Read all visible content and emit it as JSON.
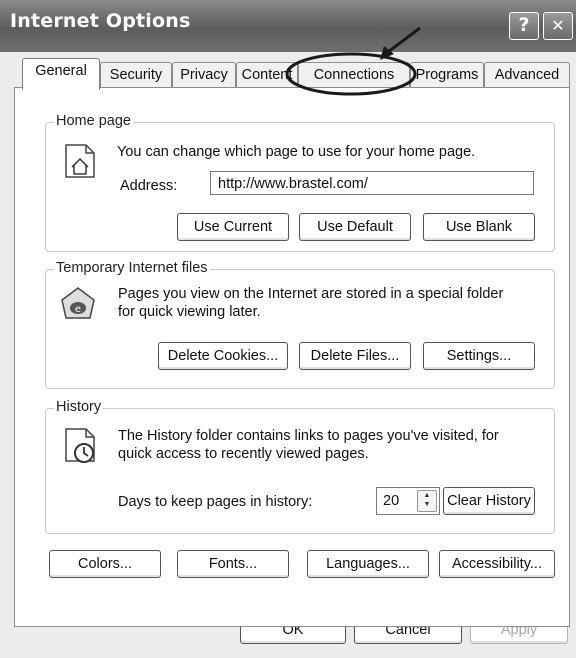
{
  "window": {
    "title": "Internet Options",
    "help_glyph": "?",
    "close_glyph": "✕"
  },
  "tabs": [
    {
      "label": "General"
    },
    {
      "label": "Security"
    },
    {
      "label": "Privacy"
    },
    {
      "label": "Content"
    },
    {
      "label": "Connections"
    },
    {
      "label": "Programs"
    },
    {
      "label": "Advanced"
    }
  ],
  "home_page": {
    "title": "Home page",
    "description": "You can change which page to use for your home page.",
    "address_label": "Address:",
    "address_value": "http://www.brastel.com/",
    "buttons": {
      "use_current": "Use Current",
      "use_default": "Use Default",
      "use_blank": "Use Blank"
    }
  },
  "temp_files": {
    "title": "Temporary Internet files",
    "description_line1": "Pages you view on the Internet are stored in a special folder",
    "description_line2": "for quick viewing later.",
    "buttons": {
      "delete_cookies": "Delete Cookies...",
      "delete_files": "Delete Files...",
      "settings": "Settings..."
    }
  },
  "history": {
    "title": "History",
    "description_line1": "The History folder contains links to pages you've visited, for",
    "description_line2": "quick access to recently viewed pages.",
    "days_label": "Days to keep pages in history:",
    "days_value": "20",
    "clear_button": "Clear History"
  },
  "bottom_buttons": {
    "colors": "Colors...",
    "fonts": "Fonts...",
    "languages": "Languages...",
    "accessibility": "Accessibility..."
  },
  "dialog_buttons": {
    "ok": "OK",
    "cancel": "Cancel",
    "apply": "Apply"
  },
  "annotation": {
    "highlight_target": "Connections",
    "stroke_color": "#1a1a1a"
  }
}
